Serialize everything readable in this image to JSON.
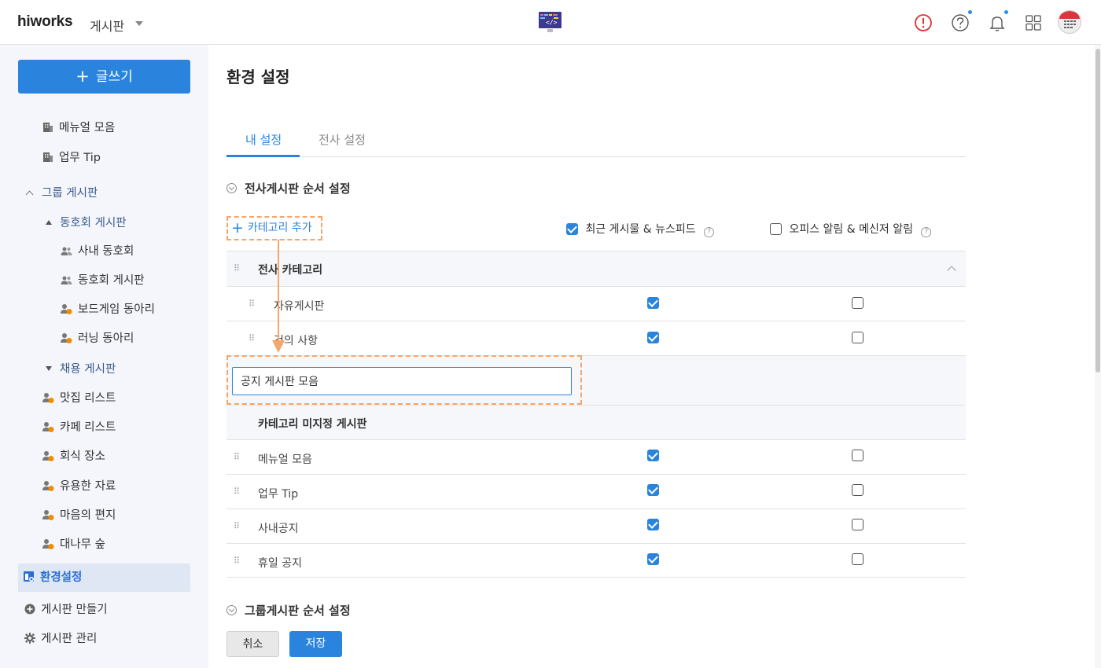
{
  "header": {
    "brand": "hiworks",
    "menu": "게시판",
    "icons": [
      "alert-circle-icon",
      "help-icon",
      "bell-icon",
      "apps-grid-icon",
      "calendar-avatar-icon"
    ],
    "accent": "#2a84dd",
    "alert_color": "#e03131"
  },
  "sidebar": {
    "write_button": "글쓰기",
    "top_items": [
      "메뉴얼 모음",
      "업무 Tip"
    ],
    "group_section": "그룹 게시판",
    "club_group": "동호회 게시판",
    "club_items": [
      "사내 동호회",
      "동호회 게시판",
      "보드게임 동아리",
      "러닝 동아리"
    ],
    "recruit_group": "채용 게시판",
    "recruit_items": [
      "맛집 리스트",
      "카페 리스트",
      "회식 장소",
      "유용한 자료",
      "마음의 편지",
      "대나무 숲"
    ],
    "settings": "환경설정",
    "create_board": "게시판 만들기",
    "manage_board": "게시판 관리"
  },
  "main": {
    "title": "환경 설정",
    "tabs": [
      "내 설정",
      "전사 설정"
    ],
    "section_company": "전사게시판 순서 설정",
    "add_category": "카테고리 추가",
    "col_recent": "최근 게시물 & 뉴스피드",
    "col_office": "오피스 알림 & 메신저 알림",
    "category_company": "전사 카테고리",
    "company_rows": [
      {
        "label": "자유게시판",
        "recent": true,
        "office": false
      },
      {
        "label": "건의 사항",
        "recent": true,
        "office": false
      }
    ],
    "new_category_value": "공지 게시판 모음",
    "category_none": "카테고리 미지정 게시판",
    "none_rows": [
      {
        "label": "메뉴얼 모음",
        "recent": true,
        "office": false
      },
      {
        "label": "업무 Tip",
        "recent": true,
        "office": false
      },
      {
        "label": "사내공지",
        "recent": true,
        "office": false
      },
      {
        "label": "휴일 공지",
        "recent": true,
        "office": false
      }
    ],
    "section_group": "그룹게시판 순서 설정",
    "cancel": "취소",
    "save": "저장"
  }
}
